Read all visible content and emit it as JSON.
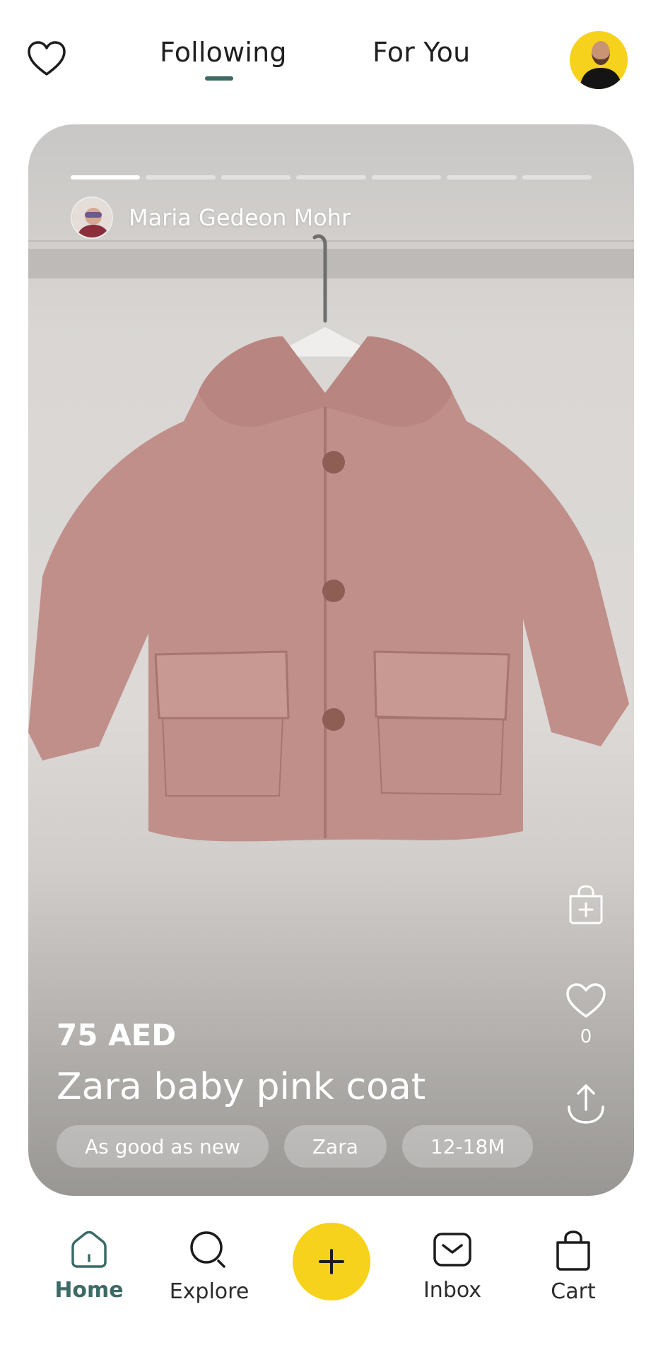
{
  "header": {
    "tabs": [
      {
        "label": "Following",
        "active": true
      },
      {
        "label": "For You",
        "active": false
      }
    ],
    "accent_color": "#3c6b66"
  },
  "post": {
    "seller_name": "Maria Gedeon Mohr",
    "story_segments": 7,
    "active_segment": 1,
    "price": "75 AED",
    "title": "Zara baby pink coat",
    "tags": [
      "As good as new",
      "Zara",
      "12-18M"
    ],
    "like_count": "0",
    "icons": [
      "add-to-bag-icon",
      "heart-icon",
      "share-icon"
    ]
  },
  "nav": {
    "items": [
      {
        "label": "Home",
        "icon": "home-icon",
        "active": true
      },
      {
        "label": "Explore",
        "icon": "search-icon",
        "active": false
      },
      {
        "label": "Inbox",
        "icon": "mail-icon",
        "active": false
      },
      {
        "label": "Cart",
        "icon": "shopping-bag-icon",
        "active": false
      }
    ],
    "add_icon": "plus-icon",
    "add_color": "#f7d21c"
  }
}
